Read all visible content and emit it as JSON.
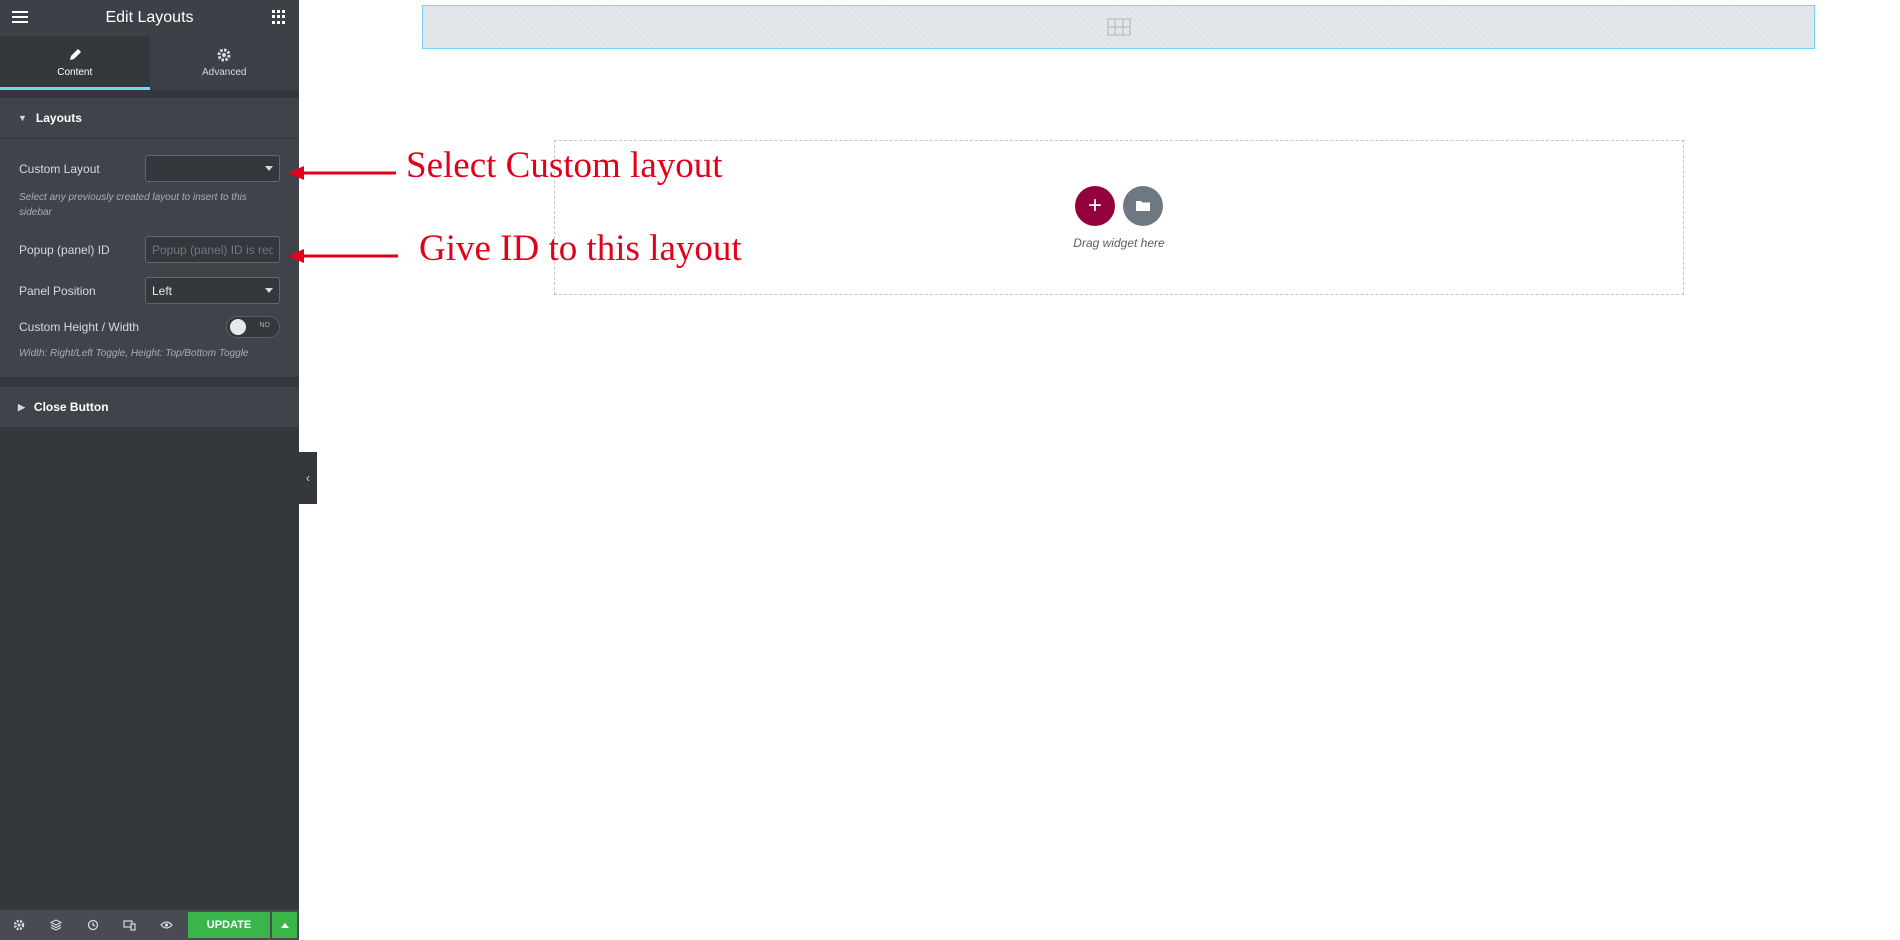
{
  "sidebar": {
    "title": "Edit Layouts",
    "tabs": [
      {
        "label": "Content",
        "active": true
      },
      {
        "label": "Advanced",
        "active": false
      }
    ],
    "sections": {
      "layouts": {
        "label": "Layouts",
        "custom_layout": {
          "label": "Custom Layout",
          "value": "",
          "description": "Select any previously created layout to insert to this sidebar"
        },
        "popup_id": {
          "label": "Popup (panel) ID",
          "placeholder": "Popup (panel) ID is req",
          "value": ""
        },
        "panel_position": {
          "label": "Panel Position",
          "value": "Left"
        },
        "custom_size": {
          "label": "Custom Height / Width",
          "toggle_label": "NO",
          "enabled": false,
          "description": "Width: Right/Left Toggle, Height: Top/Bottom Toggle"
        }
      },
      "close_button": {
        "label": "Close Button"
      }
    },
    "footer": {
      "icons": [
        "settings-icon",
        "navigator-icon",
        "history-icon",
        "responsive-icon",
        "preview-icon"
      ],
      "update_label": "UPDATE"
    }
  },
  "canvas": {
    "drag_text": "Drag widget here",
    "colors": {
      "add_button": "#93003c",
      "template_button": "#6d7882",
      "selection": "#71d7f7"
    }
  },
  "annotations": {
    "select_custom": "Select Custom layout",
    "give_id": "Give ID to this layout",
    "color": "#e3001b"
  },
  "colors": {
    "panel_bg": "#34383c",
    "update_button": "#39b54a"
  }
}
